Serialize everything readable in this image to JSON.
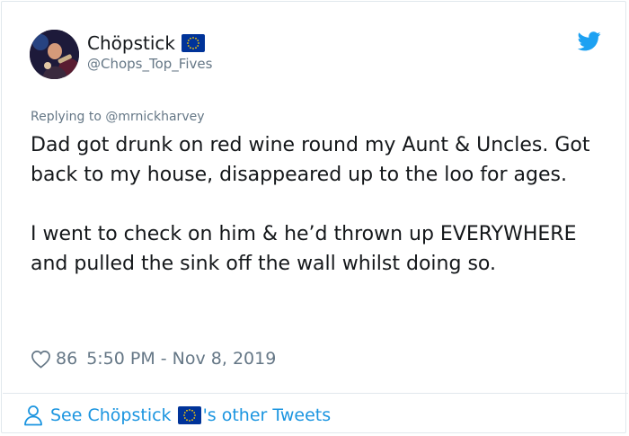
{
  "tweet": {
    "display_name": "Chöpstick",
    "handle": "@Chops_Top_Fives",
    "replying_prefix": "Replying to",
    "replying_to": "@mrnickharvey",
    "text": "Dad got drunk on red wine round my Aunt & Uncles. Got back to my house, disappeared up to the loo for ages.\n\nI went to check on him & he’d thrown up EVERYWHERE and pulled the sink off the wall whilst doing so.",
    "likes": "86",
    "timestamp": "5:50 PM - Nov 8, 2019"
  },
  "footer": {
    "see_label": "See Chöpstick",
    "other_tweets_label": "'s other Tweets"
  },
  "icons": {
    "flag": "eu-flag-icon",
    "bird": "twitter-bird-icon",
    "heart": "heart-icon",
    "person": "person-icon"
  },
  "colors": {
    "link": "#1b95e0",
    "secondary": "#657786",
    "text": "#14171a",
    "eu_blue": "#003399",
    "eu_star": "#ffcc00"
  }
}
